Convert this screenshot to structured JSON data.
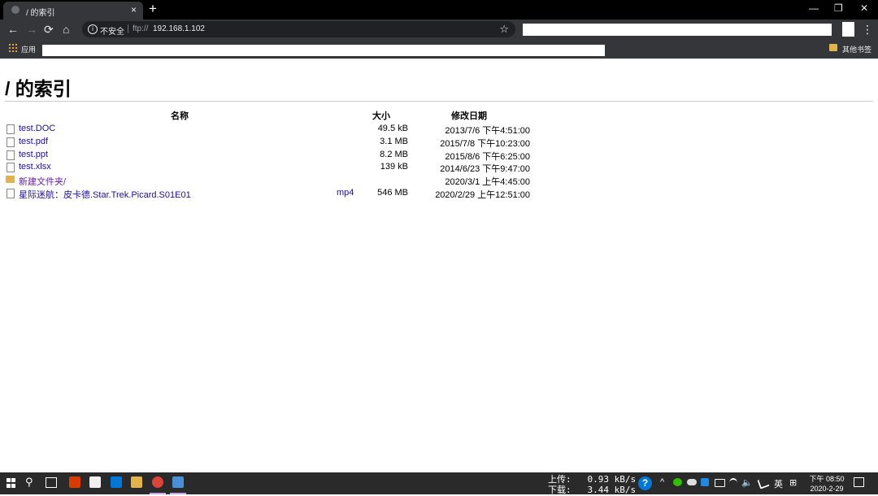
{
  "browser": {
    "tab_title": "/ 的索引",
    "tab_close": "×",
    "new_tab": "+",
    "window_controls": {
      "minimize": "—",
      "restore": "❐",
      "close": "✕"
    },
    "nav": {
      "back": "←",
      "forward": "→",
      "reload": "⟳",
      "home": "⌂"
    },
    "address": {
      "security_label": "不安全",
      "separator": "|",
      "scheme": "ftp://",
      "host": "192.168.1.102"
    },
    "bookmark_star": "☆",
    "menu": "⋮",
    "bookmarks": {
      "apps_label": "应用",
      "other_label": "其他书签"
    }
  },
  "page": {
    "title": "/ 的索引",
    "columns": {
      "name": "名称",
      "size": "大小",
      "date": "修改日期"
    },
    "files": [
      {
        "name": "test.DOC",
        "ext": "",
        "size": "49.5 kB",
        "date": "2013/7/6 下午4:51:00",
        "type": "file"
      },
      {
        "name": "test.pdf",
        "ext": "",
        "size": "3.1 MB",
        "date": "2015/7/8 下午10:23:00",
        "type": "file"
      },
      {
        "name": "test.ppt",
        "ext": "",
        "size": "8.2 MB",
        "date": "2015/8/6 下午6:25:00",
        "type": "file"
      },
      {
        "name": "test.xlsx",
        "ext": "",
        "size": "139 kB",
        "date": "2014/6/23 下午9:47:00",
        "type": "file"
      },
      {
        "name": "新建文件夹/",
        "ext": "",
        "size": "",
        "date": "2020/3/1 上午4:45:00",
        "type": "dir"
      },
      {
        "name": "星际迷航：皮卡德.Star.Trek.Picard.S01E01",
        "ext": "mp4",
        "size": "546 MB",
        "date": "2020/2/29 上午12:51:00",
        "type": "file"
      }
    ]
  },
  "taskbar": {
    "search": "⚲",
    "net_up": "上传:   0.93 kB/s",
    "net_down": "下载:   3.44 kB/s",
    "help": "?",
    "tray_caret": "^",
    "volume": "🔈",
    "ime": "英",
    "ime_mode": "⊞",
    "time": "下午 08:50",
    "date": "2020-2-29"
  }
}
